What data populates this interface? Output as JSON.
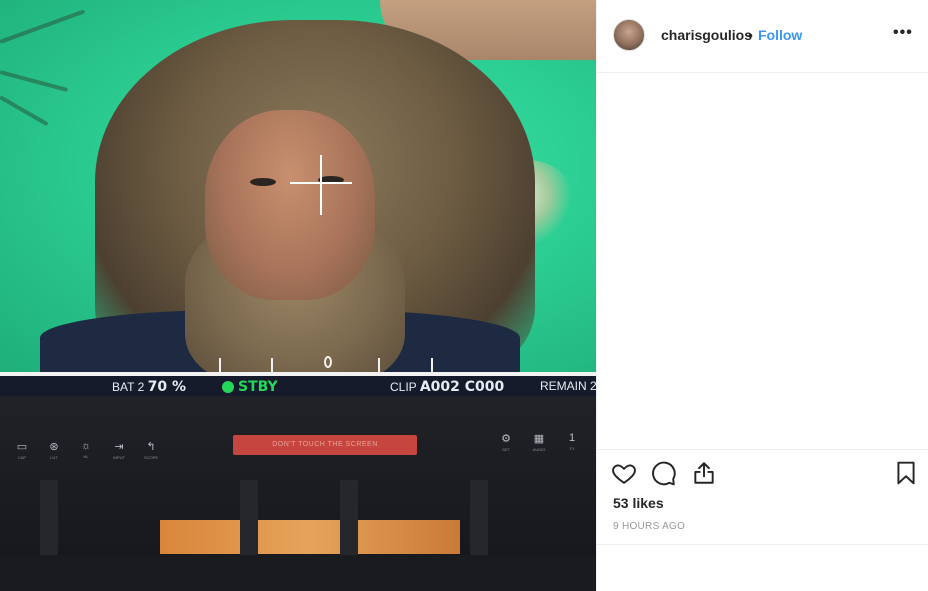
{
  "post": {
    "username": "charisgoulios",
    "separator": "•",
    "follow_label": "Follow",
    "more_label": "•••",
    "likes": "53 likes",
    "timestamp": "9 HOURS AGO"
  },
  "icons": {
    "like": "heart-icon",
    "comment": "comment-bubble-icon",
    "share": "share-icon",
    "save": "bookmark-icon",
    "more": "more-options-icon"
  },
  "photo_overlay": {
    "battery_label": "BAT 2",
    "battery_value": "70 %",
    "status": "STBY",
    "clip_label": "CLIP",
    "clip_value": "A002 C000",
    "remain_label": "REMAIN 2",
    "tape_text": "DON'T TOUCH THE SCREEN",
    "monitor_buttons": [
      "CAP",
      "LUT",
      "HL",
      "INPUT",
      "SCOPE"
    ],
    "monitor_right_buttons": [
      "SET",
      "AUDIO",
      "F1"
    ],
    "monitor_right_glyphs": [
      "⚙",
      "▦",
      "1"
    ]
  },
  "colors": {
    "accent": "#3897f0",
    "text": "#262626",
    "muted": "#999999",
    "greenscreen": "#2ccf93",
    "stby": "#24d65a",
    "tape": "#c6453e"
  }
}
